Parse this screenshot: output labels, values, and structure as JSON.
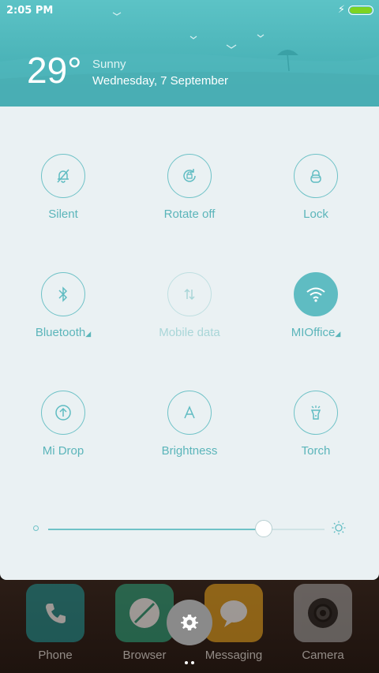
{
  "status": {
    "time": "2:05 PM",
    "charging_icon": "lightning-icon",
    "battery_color": "#7ed321"
  },
  "weather": {
    "temperature": "29°",
    "condition": "Sunny",
    "date": "Wednesday, 7 September"
  },
  "toggles": [
    {
      "label": "Silent",
      "icon": "bell-off-icon",
      "state": "off"
    },
    {
      "label": "Rotate off",
      "icon": "rotate-lock-icon",
      "state": "off"
    },
    {
      "label": "Lock",
      "icon": "lock-icon",
      "state": "off"
    },
    {
      "label": "Bluetooth",
      "icon": "bluetooth-icon",
      "state": "off",
      "has_menu": true
    },
    {
      "label": "Mobile data",
      "icon": "mobile-data-icon",
      "state": "disabled"
    },
    {
      "label": "MIOffice",
      "icon": "wifi-icon",
      "state": "on",
      "has_menu": true
    },
    {
      "label": "Mi Drop",
      "icon": "upload-icon",
      "state": "off"
    },
    {
      "label": "Brightness",
      "icon": "brightness-auto-icon",
      "state": "off"
    },
    {
      "label": "Torch",
      "icon": "flashlight-icon",
      "state": "off"
    }
  ],
  "brightness_slider": {
    "value_fraction": 0.78,
    "accent": "#6fc2c7"
  },
  "dock": {
    "apps": [
      {
        "label": "Phone",
        "icon": "phone-icon"
      },
      {
        "label": "Browser",
        "icon": "browser-icon"
      },
      {
        "label": "Messaging",
        "icon": "messaging-icon"
      },
      {
        "label": "Camera",
        "icon": "camera-icon"
      }
    ]
  },
  "colors": {
    "accent": "#5fbcc2",
    "panel_bg": "#eaf1f3"
  }
}
